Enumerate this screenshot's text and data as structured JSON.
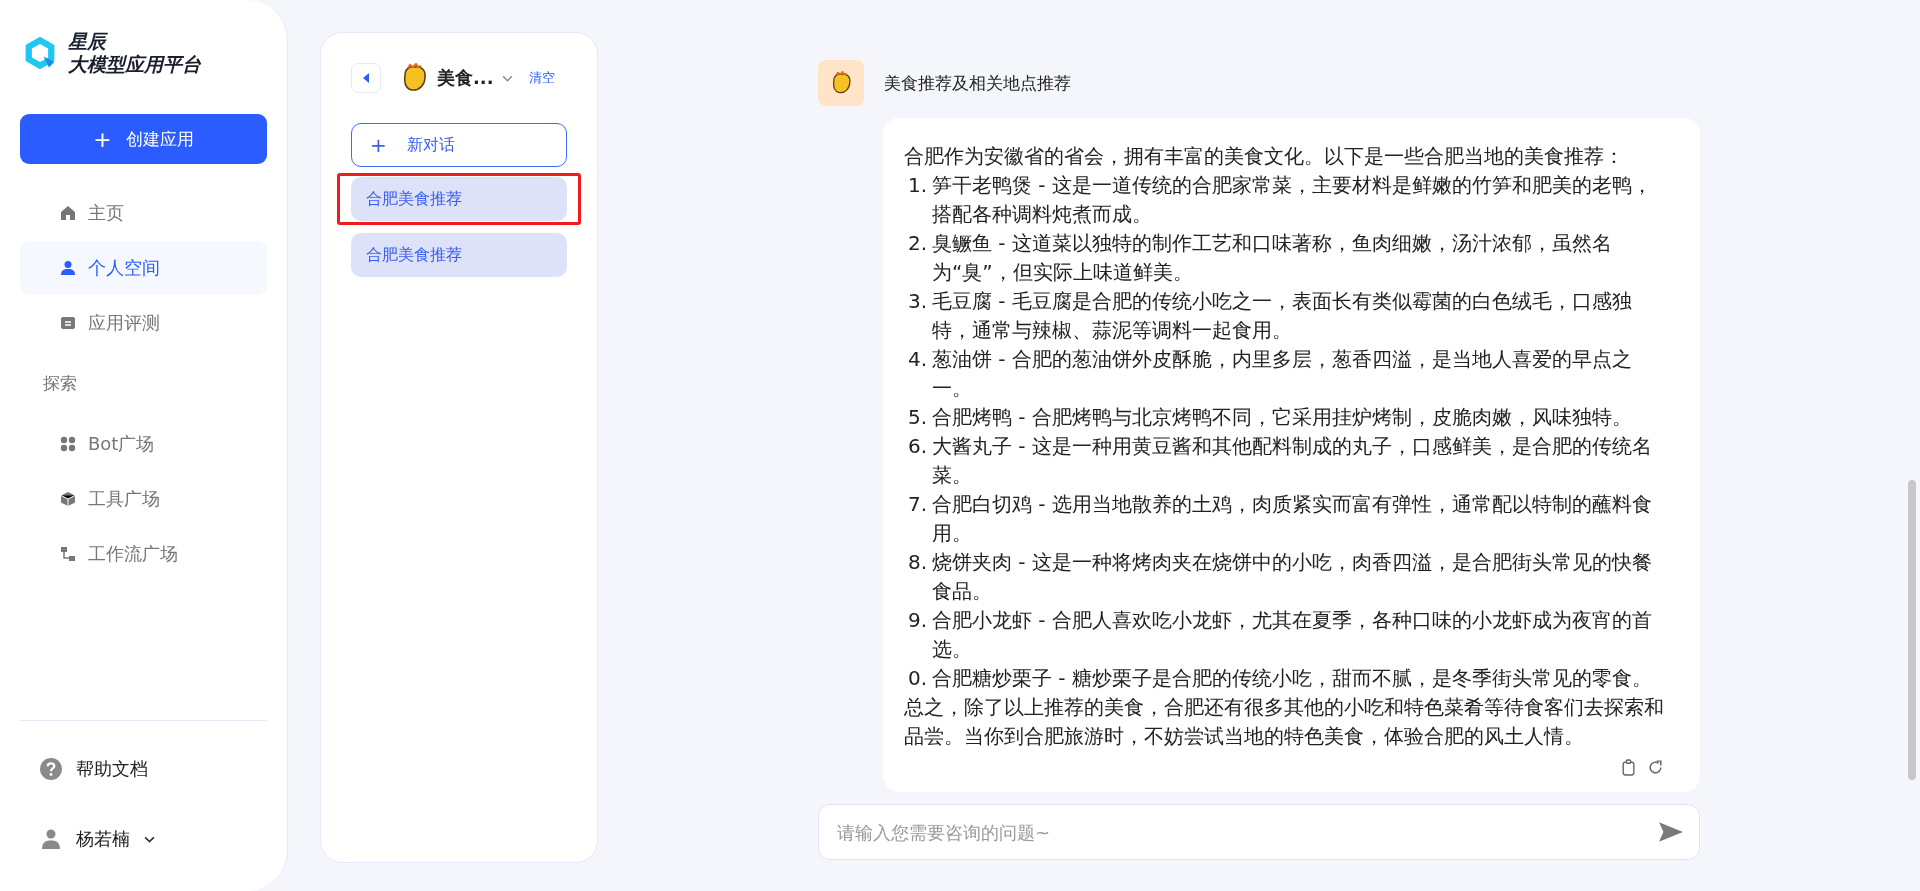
{
  "brand": {
    "line1": "星辰",
    "line2": "大模型应用平台"
  },
  "create_button": {
    "icon": "+",
    "label": "创建应用"
  },
  "nav": [
    {
      "label": "主页",
      "selected": false
    },
    {
      "label": "个人空间",
      "selected": true
    },
    {
      "label": "应用评测",
      "selected": false
    }
  ],
  "explore": {
    "heading": "探索",
    "items": [
      {
        "label": "Bot广场",
        "selected": false
      },
      {
        "label": "工具广场",
        "selected": false
      },
      {
        "label": "工作流广场",
        "selected": false
      }
    ]
  },
  "help": {
    "label": "帮助文档"
  },
  "user": {
    "name": "杨若楠"
  },
  "panel": {
    "title": "美食...",
    "clear": "清空",
    "new_chat": {
      "icon": "+",
      "label": "新对话"
    },
    "conversations": [
      {
        "label": "合肥美食推荐",
        "annotated": true
      },
      {
        "label": "合肥美食推荐",
        "annotated": false
      }
    ]
  },
  "chat": {
    "title": "美食推荐及相关地点推荐",
    "intro": "合肥作为安徽省的省会，拥有丰富的美食文化。以下是一些合肥当地的美食推荐：",
    "items": [
      {
        "number": "1.",
        "text": "笋干老鸭煲 - 这是一道传统的合肥家常菜，主要材料是鲜嫩的竹笋和肥美的老鸭，搭配各种调料炖煮而成。"
      },
      {
        "number": "2.",
        "text": "臭鳜鱼 - 这道菜以独特的制作工艺和口味著称，鱼肉细嫩，汤汁浓郁，虽然名为“臭”，但实际上味道鲜美。"
      },
      {
        "number": "3.",
        "text": "毛豆腐 - 毛豆腐是合肥的传统小吃之一，表面长有类似霉菌的白色绒毛，口感独特，通常与辣椒、蒜泥等调料一起食用。"
      },
      {
        "number": "4.",
        "text": "葱油饼 - 合肥的葱油饼外皮酥脆，内里多层，葱香四溢，是当地人喜爱的早点之一。"
      },
      {
        "number": "5.",
        "text": "合肥烤鸭 - 合肥烤鸭与北京烤鸭不同，它采用挂炉烤制，皮脆肉嫩，风味独特。"
      },
      {
        "number": "6.",
        "text": "大酱丸子 - 这是一种用黄豆酱和其他配料制成的丸子，口感鲜美，是合肥的传统名菜。"
      },
      {
        "number": "7.",
        "text": "合肥白切鸡 - 选用当地散养的土鸡，肉质紧实而富有弹性，通常配以特制的蘸料食用。"
      },
      {
        "number": "8.",
        "text": "烧饼夹肉 - 这是一种将烤肉夹在烧饼中的小吃，肉香四溢，是合肥街头常见的快餐食品。"
      },
      {
        "number": "9.",
        "text": "合肥小龙虾 - 合肥人喜欢吃小龙虾，尤其在夏季，各种口味的小龙虾成为夜宵的首选。"
      },
      {
        "number": "0.",
        "text": "合肥糖炒栗子 - 糖炒栗子是合肥的传统小吃，甜而不腻，是冬季街头常见的零食。"
      }
    ],
    "outro": "总之，除了以上推荐的美食，合肥还有很多其他的小吃和特色菜肴等待食客们去探索和品尝。当你到合肥旅游时，不妨尝试当地的特色美食，体验合肥的风土人情。"
  },
  "input": {
    "placeholder": "请输入您需要咨询的问题~"
  }
}
